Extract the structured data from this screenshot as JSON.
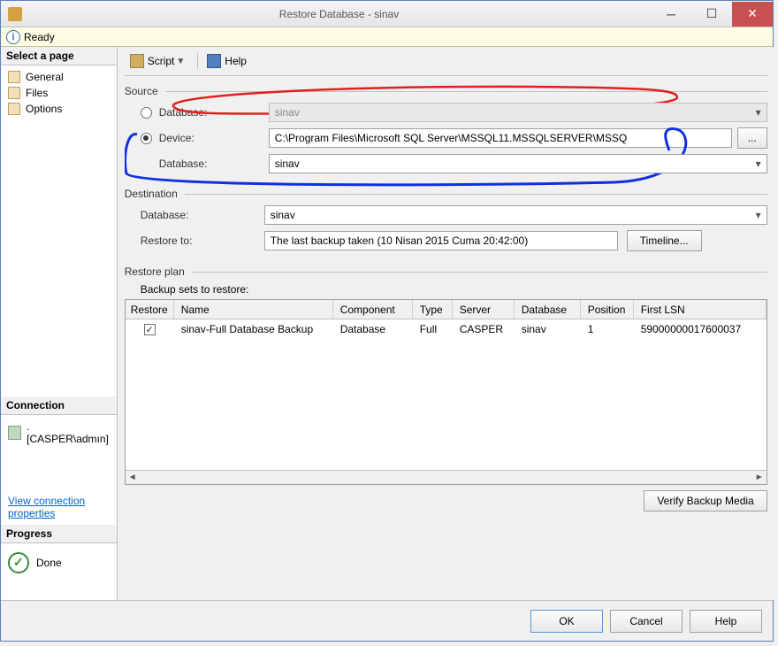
{
  "window": {
    "title": "Restore Database - sinav"
  },
  "status": {
    "text": "Ready"
  },
  "sidebar": {
    "header": "Select a page",
    "items": [
      {
        "label": "General"
      },
      {
        "label": "Files"
      },
      {
        "label": "Options"
      }
    ],
    "connection": {
      "header": "Connection",
      "value": ". [CASPER\\admın]",
      "viewLink": "View connection properties"
    },
    "progress": {
      "header": "Progress",
      "status": "Done"
    }
  },
  "toolbar": {
    "script": "Script",
    "help": "Help"
  },
  "source": {
    "groupTitle": "Source",
    "databaseRadio": "Database:",
    "databaseValue": "sinav",
    "deviceRadio": "Device:",
    "devicePath": "C:\\Program Files\\Microsoft SQL Server\\MSSQL11.MSSQLSERVER\\MSSQ",
    "browse": "...",
    "deviceDatabaseLabel": "Database:",
    "deviceDatabaseValue": "sinav"
  },
  "destination": {
    "groupTitle": "Destination",
    "databaseLabel": "Database:",
    "databaseValue": "sinav",
    "restoreToLabel": "Restore to:",
    "restoreToValue": "The last backup taken (10 Nisan 2015 Cuma 20:42:00)",
    "timelineBtn": "Timeline..."
  },
  "restorePlan": {
    "groupTitle": "Restore plan",
    "subheading": "Backup sets to restore:",
    "columns": {
      "restore": "Restore",
      "name": "Name",
      "component": "Component",
      "type": "Type",
      "server": "Server",
      "database": "Database",
      "position": "Position",
      "firstLsn": "First LSN"
    },
    "rows": [
      {
        "restore": true,
        "name": "sinav-Full Database Backup",
        "component": "Database",
        "type": "Full",
        "server": "CASPER",
        "database": "sinav",
        "position": "1",
        "firstLsn": "59000000017600037"
      }
    ],
    "verifyBtn": "Verify Backup Media"
  },
  "buttons": {
    "ok": "OK",
    "cancel": "Cancel",
    "help": "Help"
  }
}
